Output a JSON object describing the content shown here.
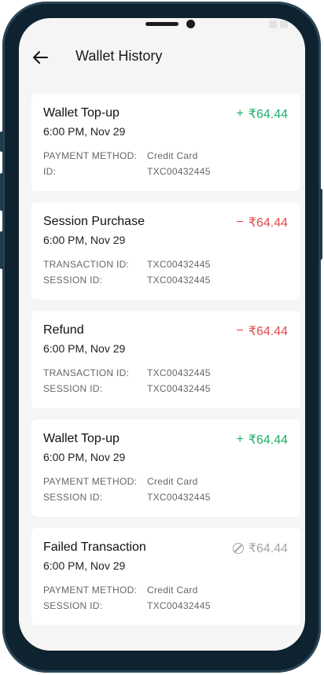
{
  "header": {
    "title": "Wallet History",
    "back_icon": "arrow-left-icon"
  },
  "transactions": [
    {
      "title": "Wallet Top-up",
      "time": "6:00 PM, Nov 29",
      "sign": "+",
      "amount": "₹64.44",
      "status": "credit",
      "rows": [
        {
          "label": "PAYMENT METHOD:",
          "value": "Credit Card"
        },
        {
          "label": "ID:",
          "value": "TXC00432445"
        }
      ]
    },
    {
      "title": "Session Purchase",
      "time": "6:00 PM, Nov 29",
      "sign": "−",
      "amount": "₹64.44",
      "status": "debit",
      "rows": [
        {
          "label": "TRANSACTION ID:",
          "value": "TXC00432445"
        },
        {
          "label": "SESSION ID:",
          "value": "TXC00432445"
        }
      ]
    },
    {
      "title": "Refund",
      "time": "6:00 PM, Nov 29",
      "sign": "−",
      "amount": "₹64.44",
      "status": "debit",
      "rows": [
        {
          "label": "TRANSACTION ID:",
          "value": "TXC00432445"
        },
        {
          "label": "SESSION ID:",
          "value": "TXC00432445"
        }
      ]
    },
    {
      "title": "Wallet Top-up",
      "time": "6:00 PM, Nov 29",
      "sign": "+",
      "amount": "₹64.44",
      "status": "credit",
      "rows": [
        {
          "label": "PAYMENT METHOD:",
          "value": "Credit Card"
        },
        {
          "label": "SESSION ID:",
          "value": "TXC00432445"
        }
      ]
    },
    {
      "title": "Failed Transaction",
      "time": "6:00 PM, Nov 29",
      "sign": "",
      "amount": "₹64.44",
      "status": "failed",
      "rows": [
        {
          "label": "PAYMENT METHOD:",
          "value": "Credit Card"
        },
        {
          "label": "SESSION ID:",
          "value": "TXC00432445"
        }
      ]
    }
  ],
  "colors": {
    "credit": "#1eae6a",
    "debit": "#e34a4a",
    "failed": "#a6a6a6"
  }
}
